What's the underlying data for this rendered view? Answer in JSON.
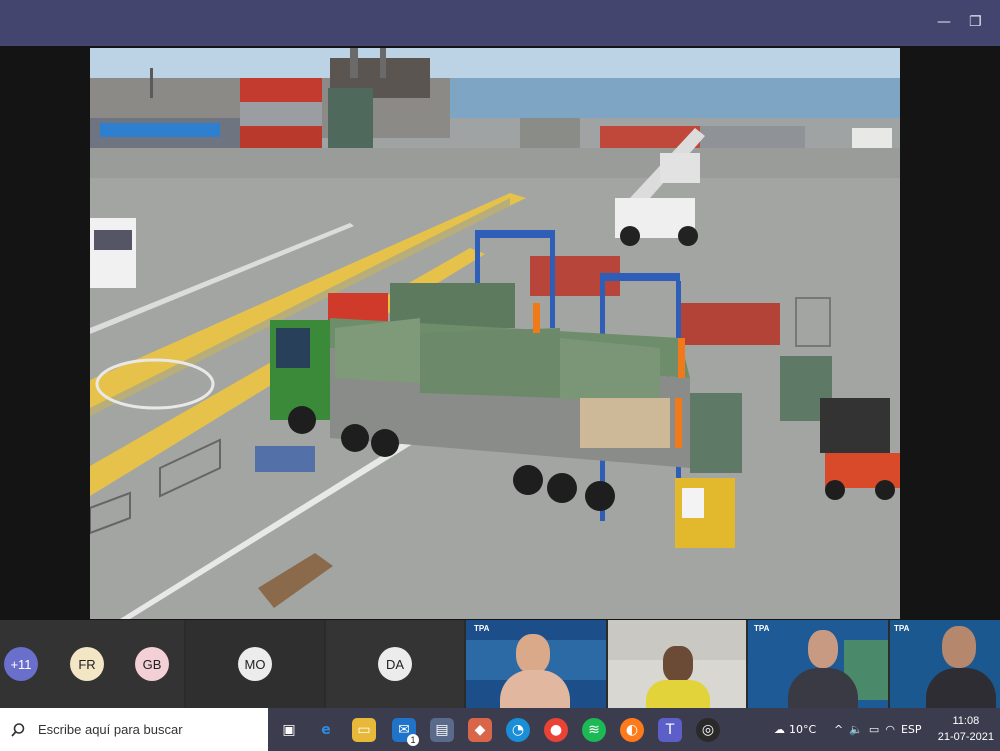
{
  "window": {
    "minimize_glyph": "—",
    "maximize_glyph": "❐"
  },
  "participants": {
    "overflow_count": "+11",
    "avatars": [
      {
        "initials": "FR",
        "color": "#f3e6c5"
      },
      {
        "initials": "GB",
        "color": "#f3cfd6"
      },
      {
        "initials": "MO",
        "color": "#ececec"
      },
      {
        "initials": "DA",
        "color": "#ececec"
      }
    ],
    "video_tiles": [
      {
        "logo": "TPA"
      },
      {
        "logo": ""
      },
      {
        "logo": "TPA"
      },
      {
        "logo": "TPA"
      }
    ]
  },
  "taskbar": {
    "search_placeholder": "Escribe aquí para buscar",
    "weather": "10°C",
    "language": "ESP",
    "time": "11:08",
    "date": "21-07-2021",
    "badge_count": "1",
    "icons": [
      "task-view-icon",
      "edge-legacy-icon",
      "file-explorer-icon",
      "mail-icon",
      "notes-icon",
      "teams-app-icon",
      "edge-icon",
      "chrome-icon",
      "spotify-icon",
      "firefox-icon",
      "teams-icon",
      "obs-icon"
    ]
  },
  "colors": {
    "titlebar": "#44456f",
    "taskbar": "#3b3d4e",
    "accent_yellow": "#e6c24a"
  }
}
